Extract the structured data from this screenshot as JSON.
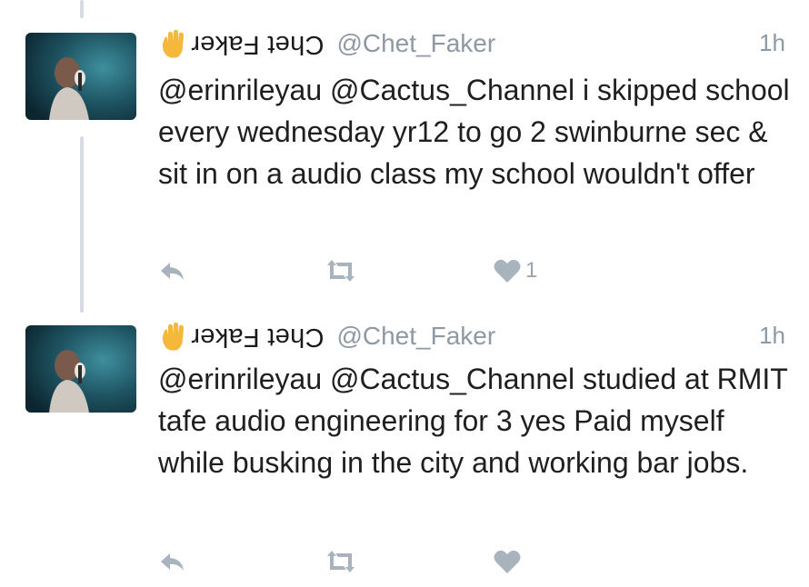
{
  "colors": {
    "thread_line": "#d7dce2",
    "meta_gray": "#8f99a3",
    "action_gray": "#a9b3bd",
    "hand_yellow": "#f5b83a"
  },
  "tweets": [
    {
      "display_name": "Chet Faker",
      "handle": "@Chet_Faker",
      "time": "1h",
      "text": "@erinrileyau @Cactus_Channel i skipped school every wednesday yr12 to go 2 swinburne sec & sit in on a audio class my school wouldn't offer",
      "like_count": "1",
      "icons": [
        "raised-hand-icon",
        "reply-icon",
        "retweet-icon",
        "heart-icon"
      ]
    },
    {
      "display_name": "Chet Faker",
      "handle": "@Chet_Faker",
      "time": "1h",
      "text": "@erinrileyau @Cactus_Channel studied at RMIT tafe audio engineering for 3 yes Paid myself while busking in the city and working bar jobs.",
      "like_count": "",
      "icons": [
        "raised-hand-icon",
        "reply-icon",
        "retweet-icon",
        "heart-icon"
      ]
    }
  ]
}
